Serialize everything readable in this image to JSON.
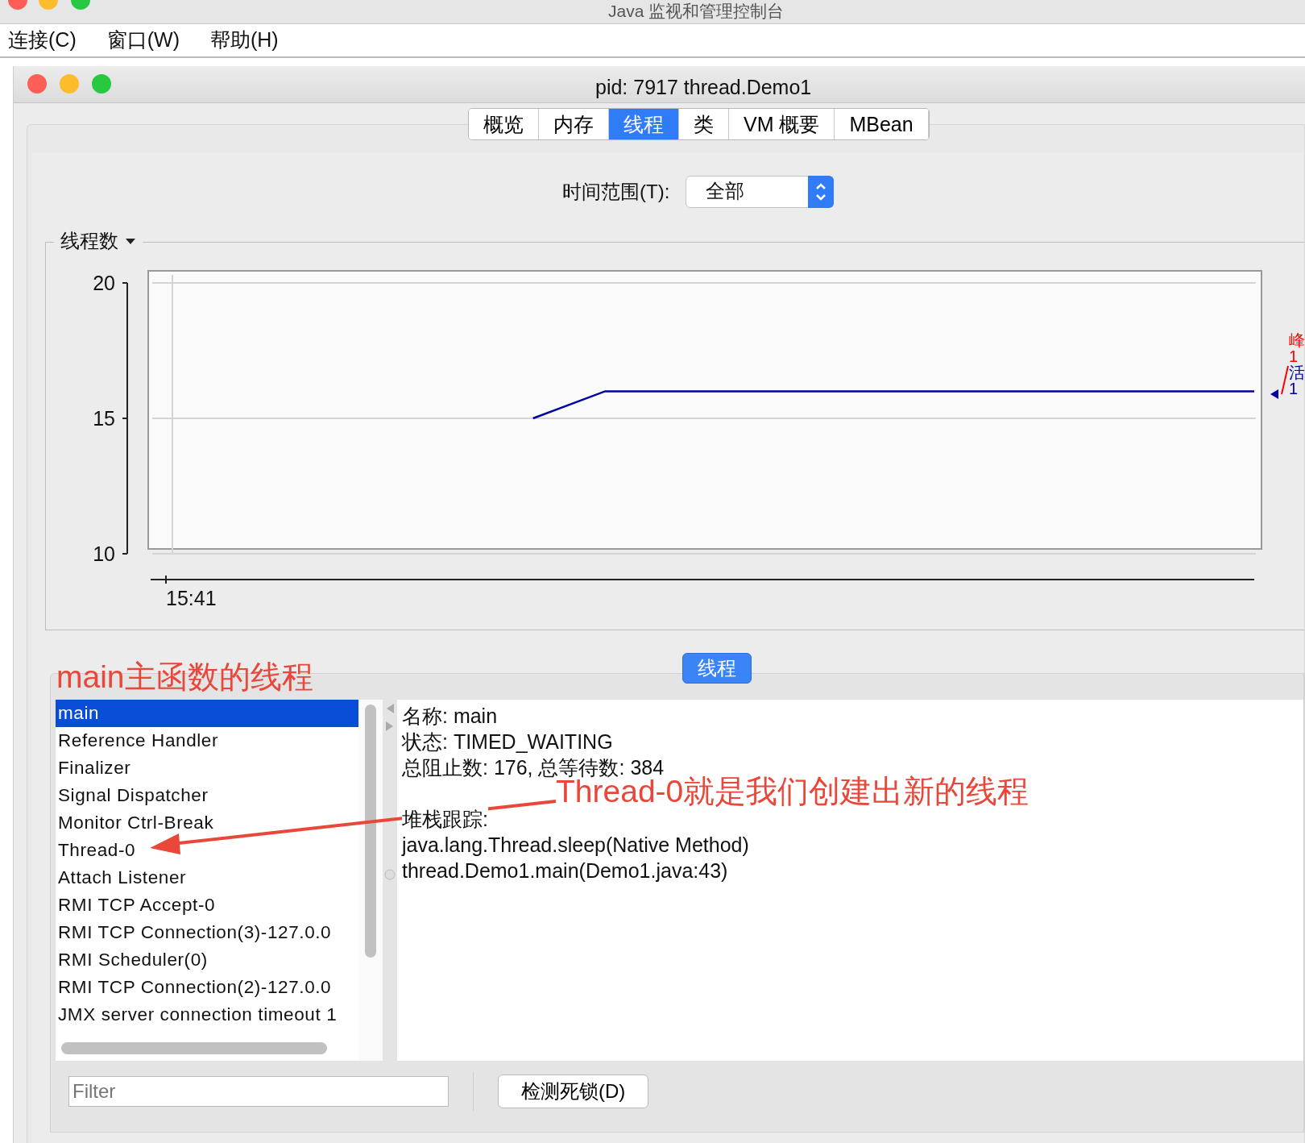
{
  "app_window": {
    "title": "Java 监视和管理控制台"
  },
  "menu": [
    "连接(C)",
    "窗口(W)",
    "帮助(H)"
  ],
  "window": {
    "title": "pid: 7917 thread.Demo1"
  },
  "tabs": [
    {
      "label": "概览",
      "selected": false
    },
    {
      "label": "内存",
      "selected": false
    },
    {
      "label": "线程",
      "selected": true
    },
    {
      "label": "类",
      "selected": false
    },
    {
      "label": "VM 概要",
      "selected": false
    },
    {
      "label": "MBean",
      "selected": false
    }
  ],
  "time_range": {
    "label": "时间范围(T):",
    "value": "全部"
  },
  "chart_panel": {
    "title": "线程数",
    "chart_data": {
      "type": "line",
      "ylim": [
        10,
        20
      ],
      "yticks": [
        {
          "value": 10,
          "label": "10"
        },
        {
          "value": 15,
          "label": "15"
        },
        {
          "value": 20,
          "label": "20"
        }
      ],
      "series": [
        {
          "color": "#0000a0",
          "values": [
            null,
            null,
            null,
            null,
            null,
            15,
            16,
            16,
            16,
            16,
            16,
            16,
            16,
            16,
            16,
            16
          ]
        }
      ],
      "annotations": [
        "15:41"
      ]
    },
    "legend": [
      {
        "label": "峰",
        "value": "1",
        "color": "#ff0000"
      },
      {
        "label": "活",
        "value": "1",
        "color": "#0000a0"
      }
    ]
  },
  "threads_panel": {
    "title": "线程",
    "threads": [
      {
        "name": "main",
        "selected": true
      },
      {
        "name": "Reference Handler",
        "selected": false
      },
      {
        "name": "Finalizer",
        "selected": false
      },
      {
        "name": "Signal Dispatcher",
        "selected": false
      },
      {
        "name": "Monitor Ctrl-Break",
        "selected": false
      },
      {
        "name": "Thread-0",
        "selected": false
      },
      {
        "name": "Attach Listener",
        "selected": false
      },
      {
        "name": "RMI TCP Accept-0",
        "selected": false
      },
      {
        "name": "RMI TCP Connection(3)-127.0.0",
        "selected": false
      },
      {
        "name": "RMI Scheduler(0)",
        "selected": false
      },
      {
        "name": "RMI TCP Connection(2)-127.0.0",
        "selected": false
      },
      {
        "name": "JMX server connection timeout 1",
        "selected": false
      }
    ],
    "details": [
      "名称: main",
      "状态: TIMED_WAITING",
      "总阻止数: 176, 总等待数: 384"
    ],
    "stack_title": "堆栈跟踪:",
    "stack": [
      "java.lang.Thread.sleep(Native Method)",
      "thread.Demo1.main(Demo1.java:43)"
    ],
    "filter": {
      "placeholder": "Filter"
    },
    "deadlock_button": "检测死锁(D)"
  },
  "annotations": [
    {
      "text": "main主函数的线程"
    },
    {
      "text": "Thread-0就是我们创建出新的线程"
    }
  ]
}
